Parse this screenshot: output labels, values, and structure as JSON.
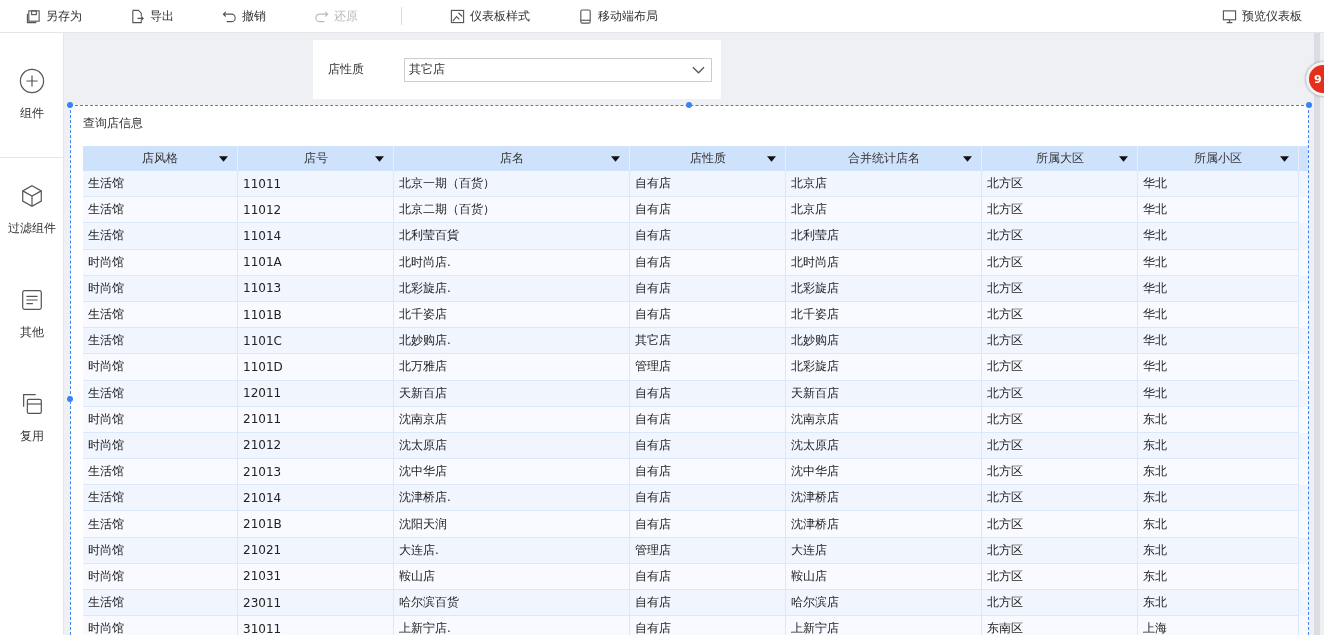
{
  "toolbar": {
    "items": [
      {
        "label": "另存为",
        "disabled": false
      },
      {
        "label": "导出",
        "disabled": false
      },
      {
        "label": "撤销",
        "disabled": false
      },
      {
        "label": "还原",
        "disabled": true
      },
      {
        "label": "仪表板样式",
        "disabled": false
      },
      {
        "label": "移动端布局",
        "disabled": false
      }
    ],
    "preview": {
      "label": "预览仪表板"
    }
  },
  "sidebar": {
    "items": [
      {
        "label": "组件"
      },
      {
        "label": "过滤组件"
      },
      {
        "label": "其他"
      },
      {
        "label": "复用"
      }
    ]
  },
  "filter": {
    "label": "店性质",
    "value": "其它店"
  },
  "badge": "9",
  "table": {
    "title": "查询店信息",
    "columns": [
      "店风格",
      "店号",
      "店名",
      "店性质",
      "合并统计店名",
      "所属大区",
      "所属小区"
    ],
    "rows": [
      [
        "生活馆",
        "11011",
        "北京一期（百货）",
        "自有店",
        "北京店",
        "北方区",
        "华北"
      ],
      [
        "生活馆",
        "11012",
        "北京二期（百货）",
        "自有店",
        "北京店",
        "北方区",
        "华北"
      ],
      [
        "生活馆",
        "11014",
        "北利莹百貨",
        "自有店",
        "北利莹店",
        "北方区",
        "华北"
      ],
      [
        "时尚馆",
        "1101A",
        "北时尚店.",
        "自有店",
        "北时尚店",
        "北方区",
        "华北"
      ],
      [
        "时尚馆",
        "11013",
        "北彩旋店.",
        "自有店",
        "北彩旋店",
        "北方区",
        "华北"
      ],
      [
        "生活馆",
        "1101B",
        "北千姿店",
        "自有店",
        "北千姿店",
        "北方区",
        "华北"
      ],
      [
        "生活馆",
        "1101C",
        "北妙购店.",
        "其它店",
        "北妙购店",
        "北方区",
        "华北"
      ],
      [
        "时尚馆",
        "1101D",
        "北万雅店",
        "管理店",
        "北彩旋店",
        "北方区",
        "华北"
      ],
      [
        "生活馆",
        "12011",
        "天新百店",
        "自有店",
        "天新百店",
        "北方区",
        "华北"
      ],
      [
        "时尚馆",
        "21011",
        "沈南京店",
        "自有店",
        "沈南京店",
        "北方区",
        "东北"
      ],
      [
        "时尚馆",
        "21012",
        "沈太原店",
        "自有店",
        "沈太原店",
        "北方区",
        "东北"
      ],
      [
        "生活馆",
        "21013",
        "沈中华店",
        "自有店",
        "沈中华店",
        "北方区",
        "东北"
      ],
      [
        "生活馆",
        "21014",
        "沈津桥店.",
        "自有店",
        "沈津桥店",
        "北方区",
        "东北"
      ],
      [
        "生活馆",
        "2101B",
        "沈阳天润",
        "自有店",
        "沈津桥店",
        "北方区",
        "东北"
      ],
      [
        "时尚馆",
        "21021",
        "大连店.",
        "管理店",
        "大连店",
        "北方区",
        "东北"
      ],
      [
        "时尚馆",
        "21031",
        "鞍山店",
        "自有店",
        "鞍山店",
        "北方区",
        "东北"
      ],
      [
        "生活馆",
        "23011",
        "哈尔滨百货",
        "自有店",
        "哈尔滨店",
        "北方区",
        "东北"
      ],
      [
        "时尚馆",
        "31011",
        "上新宁店.",
        "自有店",
        "上新宁店",
        "东南区",
        "上海"
      ]
    ]
  }
}
